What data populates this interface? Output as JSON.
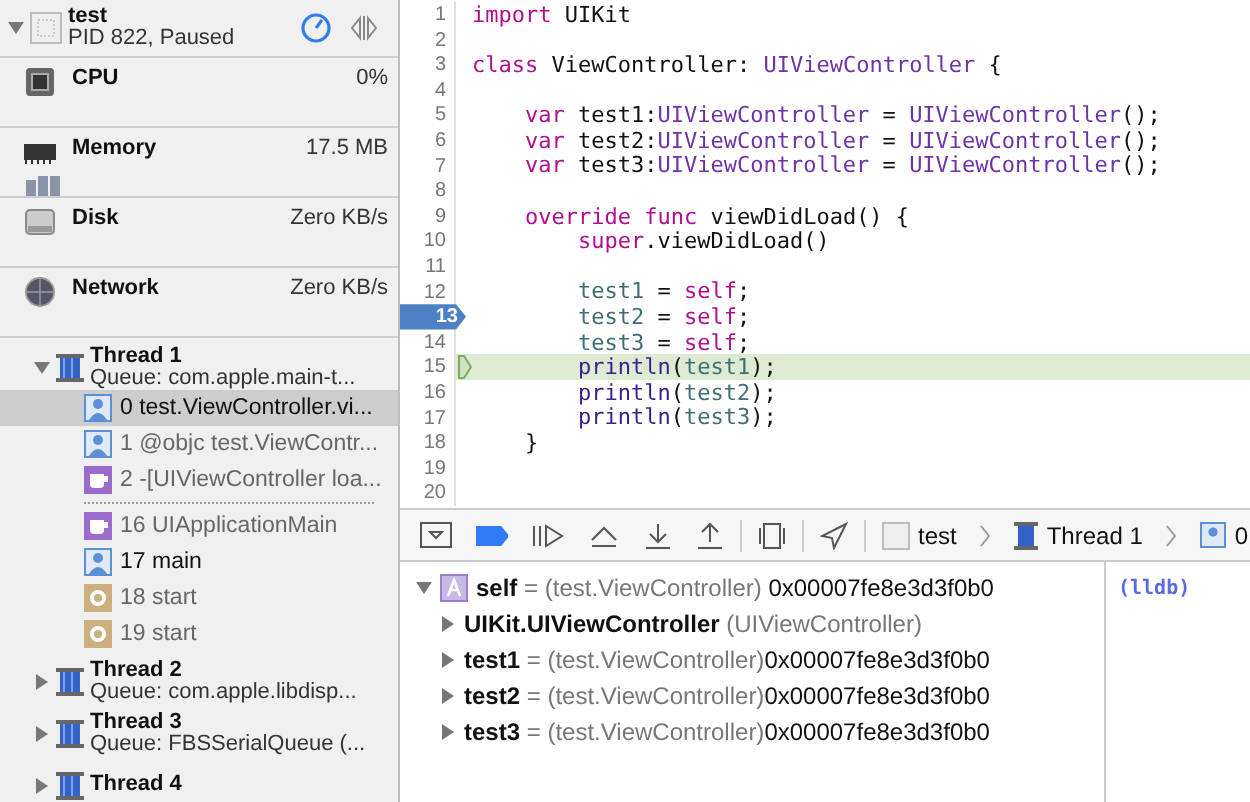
{
  "process": {
    "name": "test",
    "status": "PID 822, Paused",
    "expanded": true
  },
  "gauges": [
    {
      "kind": "cpu",
      "label": "CPU",
      "value": "0%"
    },
    {
      "kind": "memory",
      "label": "Memory",
      "value": "17.5 MB"
    },
    {
      "kind": "disk",
      "label": "Disk",
      "value": "Zero KB/s"
    },
    {
      "kind": "network",
      "label": "Network",
      "value": "Zero KB/s"
    }
  ],
  "threads": [
    {
      "name": "Thread 1",
      "queue": "Queue: com.apple.main-t...",
      "expanded": true,
      "frames": [
        {
          "kind": "user",
          "label": "0 test.ViewController.vi...",
          "selected": true,
          "dimmed": false
        },
        {
          "kind": "user",
          "label": "1 @objc test.ViewContr...",
          "selected": false,
          "dimmed": true
        },
        {
          "kind": "framework",
          "label": "2 -[UIViewController loa...",
          "selected": false,
          "dimmed": true
        },
        {
          "kind": "separator"
        },
        {
          "kind": "framework",
          "label": "16 UIApplicationMain",
          "selected": false,
          "dimmed": true
        },
        {
          "kind": "user",
          "label": "17 main",
          "selected": false,
          "dimmed": false
        },
        {
          "kind": "system",
          "label": "18 start",
          "selected": false,
          "dimmed": true
        },
        {
          "kind": "system",
          "label": "19 start",
          "selected": false,
          "dimmed": true
        }
      ]
    },
    {
      "name": "Thread 2",
      "queue": "Queue: com.apple.libdisp...",
      "expanded": false
    },
    {
      "name": "Thread 3",
      "queue": "Queue: FBSSerialQueue (...",
      "expanded": false
    },
    {
      "name": "Thread 4",
      "expanded": false
    }
  ],
  "code": {
    "lines": [
      {
        "number": "1",
        "breakpoint": false,
        "current": false,
        "tokens": [
          {
            "kind": "keyword",
            "text": "import"
          },
          {
            "kind": "plain",
            "text": " UIKit"
          }
        ]
      },
      {
        "number": "2",
        "breakpoint": false,
        "current": false
      },
      {
        "number": "3",
        "breakpoint": false,
        "current": false,
        "tokens": [
          {
            "kind": "keyword",
            "text": "class"
          },
          {
            "kind": "plain",
            "text": " ViewController: "
          },
          {
            "kind": "type",
            "text": "UIViewController"
          },
          {
            "kind": "plain",
            "text": " {"
          }
        ]
      },
      {
        "number": "4",
        "breakpoint": false,
        "current": false
      },
      {
        "number": "5",
        "breakpoint": false,
        "current": false,
        "tokens": [
          {
            "kind": "keyword",
            "text": "    var"
          },
          {
            "kind": "plain",
            "text": " test1:"
          },
          {
            "kind": "type",
            "text": "UIViewController"
          },
          {
            "kind": "plain",
            "text": " = "
          },
          {
            "kind": "type",
            "text": "UIViewController"
          },
          {
            "kind": "plain",
            "text": "();"
          }
        ]
      },
      {
        "number": "6",
        "breakpoint": false,
        "current": false,
        "tokens": [
          {
            "kind": "keyword",
            "text": "    var"
          },
          {
            "kind": "plain",
            "text": " test2:"
          },
          {
            "kind": "type",
            "text": "UIViewController"
          },
          {
            "kind": "plain",
            "text": " = "
          },
          {
            "kind": "type",
            "text": "UIViewController"
          },
          {
            "kind": "plain",
            "text": "();"
          }
        ]
      },
      {
        "number": "7",
        "breakpoint": false,
        "current": false,
        "tokens": [
          {
            "kind": "keyword",
            "text": "    var"
          },
          {
            "kind": "plain",
            "text": " test3:"
          },
          {
            "kind": "type",
            "text": "UIViewController"
          },
          {
            "kind": "plain",
            "text": " = "
          },
          {
            "kind": "type",
            "text": "UIViewController"
          },
          {
            "kind": "plain",
            "text": "();"
          }
        ]
      },
      {
        "number": "8",
        "breakpoint": false,
        "current": false
      },
      {
        "number": "9",
        "breakpoint": false,
        "current": false,
        "tokens": [
          {
            "kind": "keyword",
            "text": "    override func"
          },
          {
            "kind": "plain",
            "text": " viewDidLoad() {"
          }
        ]
      },
      {
        "number": "10",
        "breakpoint": false,
        "current": false,
        "tokens": [
          {
            "kind": "keyword",
            "text": "        super"
          },
          {
            "kind": "plain",
            "text": ".viewDidLoad()"
          }
        ]
      },
      {
        "number": "11",
        "breakpoint": false,
        "current": false
      },
      {
        "number": "12",
        "breakpoint": false,
        "current": false,
        "tokens": [
          {
            "kind": "var",
            "text": "        test1"
          },
          {
            "kind": "plain",
            "text": " = "
          },
          {
            "kind": "keyword",
            "text": "self"
          },
          {
            "kind": "plain",
            "text": ";"
          }
        ]
      },
      {
        "number": "13",
        "breakpoint": true,
        "current": false,
        "tokens": [
          {
            "kind": "var",
            "text": "        test2"
          },
          {
            "kind": "plain",
            "text": " = "
          },
          {
            "kind": "keyword",
            "text": "self"
          },
          {
            "kind": "plain",
            "text": ";"
          }
        ]
      },
      {
        "number": "14",
        "breakpoint": false,
        "current": false,
        "tokens": [
          {
            "kind": "var",
            "text": "        test3"
          },
          {
            "kind": "plain",
            "text": " = "
          },
          {
            "kind": "keyword",
            "text": "self"
          },
          {
            "kind": "plain",
            "text": ";"
          }
        ]
      },
      {
        "number": "15",
        "breakpoint": false,
        "current": true,
        "tokens": [
          {
            "kind": "func",
            "text": "        println"
          },
          {
            "kind": "plain",
            "text": "("
          },
          {
            "kind": "var",
            "text": "test1"
          },
          {
            "kind": "plain",
            "text": ");"
          }
        ]
      },
      {
        "number": "16",
        "breakpoint": false,
        "current": false,
        "tokens": [
          {
            "kind": "func",
            "text": "        println"
          },
          {
            "kind": "plain",
            "text": "("
          },
          {
            "kind": "var",
            "text": "test2"
          },
          {
            "kind": "plain",
            "text": ");"
          }
        ]
      },
      {
        "number": "17",
        "breakpoint": false,
        "current": false,
        "tokens": [
          {
            "kind": "func",
            "text": "        println"
          },
          {
            "kind": "plain",
            "text": "("
          },
          {
            "kind": "var",
            "text": "test3"
          },
          {
            "kind": "plain",
            "text": ");"
          }
        ]
      },
      {
        "number": "18",
        "breakpoint": false,
        "current": false,
        "tokens": [
          {
            "kind": "plain",
            "text": "    }"
          }
        ]
      },
      {
        "number": "19",
        "breakpoint": false,
        "current": false
      },
      {
        "number": "20",
        "breakpoint": false,
        "current": false
      }
    ]
  },
  "debug_bar": {
    "breakpoints_active": true,
    "breadcrumb": [
      "test",
      "Thread 1",
      "0"
    ]
  },
  "variables": [
    {
      "name": "self",
      "type": "= (test.ViewController)",
      "value": "0x00007fe8e3d3f0b0",
      "expanded": true,
      "children": [
        {
          "name": "UIKit.UIViewController",
          "type": "(UIViewController)",
          "expanded": false
        },
        {
          "name": "test1",
          "type": "= (test.ViewController)",
          "value": "0x00007fe8e3d3f0b0",
          "expanded": false
        },
        {
          "name": "test2",
          "type": "= (test.ViewController)",
          "value": "0x00007fe8e3d3f0b0",
          "expanded": false
        },
        {
          "name": "test3",
          "type": "= (test.ViewController)",
          "value": "0x00007fe8e3d3f0b0",
          "expanded": false
        }
      ]
    }
  ],
  "console": {
    "prompt": "(lldb)"
  }
}
